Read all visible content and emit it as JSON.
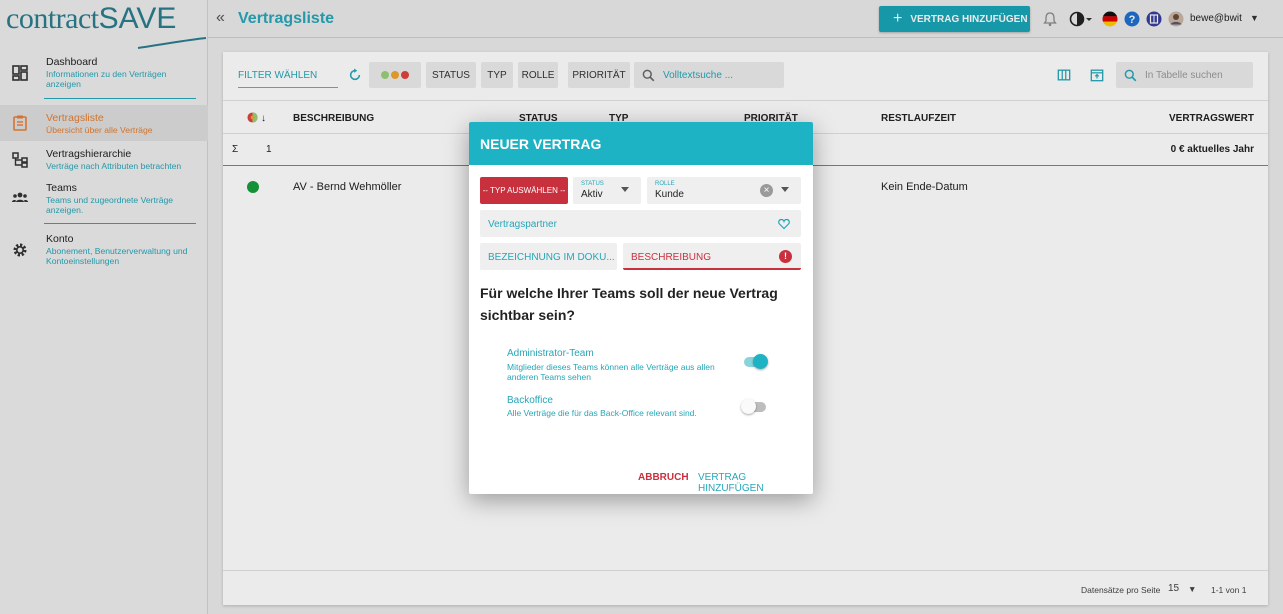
{
  "app": {
    "logo_text_a": "contract",
    "logo_text_b": "SAVE"
  },
  "sidebar": {
    "items": [
      {
        "title": "Dashboard",
        "subtitle": "Informationen zu den Verträgen anzeigen",
        "icon": "dashboard-icon"
      },
      {
        "title": "Vertragsliste",
        "subtitle": "Übersicht über alle Verträge",
        "icon": "clipboard-icon"
      },
      {
        "title": "Vertragshierarchie",
        "subtitle": "Verträge nach Attributen betrachten",
        "icon": "hierarchy-icon"
      },
      {
        "title": "Teams",
        "subtitle": "Teams und zugeordnete Verträge anzeigen.",
        "icon": "teams-icon"
      },
      {
        "title": "Konto",
        "subtitle": "Abonement, Benutzerverwaltung und Kontoeinstellungen",
        "icon": "gear-icon"
      }
    ]
  },
  "header": {
    "title": "Vertragsliste",
    "add_button": "VERTRAG HINZUFÜGEN",
    "user": "bewe@bwit"
  },
  "toolbar": {
    "filter_label": "FILTER WÄHLEN",
    "chips": [
      "STATUS",
      "TYP",
      "ROLLE",
      "PRIORITÄT"
    ],
    "fulltext_placeholder": "Volltextsuche ...",
    "table_search_placeholder": "In Tabelle suchen"
  },
  "table": {
    "headers": [
      "BESCHREIBUNG",
      "STATUS",
      "TYP",
      "PRIORITÄT",
      "RESTLAUFZEIT",
      "VERTRAGSWERT"
    ],
    "sum_symbol": "Σ",
    "sum_count": "1",
    "sum_value": "0 € aktuelles Jahr",
    "rows": [
      {
        "beschreibung": "AV - Bernd Wehmöller",
        "restlaufzeit": "Kein Ende-Datum"
      }
    ],
    "footer": {
      "per_page_label": "Datensätze pro Seite",
      "per_page": "15",
      "range": "1-1 von 1"
    }
  },
  "dialog": {
    "title": "NEUER VERTRAG",
    "typ_button": "-- TYP AUSWÄHLEN --",
    "status_label": "STATUS",
    "status_value": "Aktiv",
    "rolle_label": "ROLLE",
    "rolle_value": "Kunde",
    "partner_placeholder": "Vertragspartner",
    "bezeichnung_placeholder": "BEZEICHNUNG IM DOKU...",
    "beschreibung_placeholder": "BESCHREIBUNG",
    "question": "Für welche Ihrer Teams soll der neue Vertrag sichtbar sein?",
    "teams": [
      {
        "name": "Administrator-Team",
        "desc": "Mitglieder dieses Teams können alle Verträge aus allen anderen Teams sehen",
        "enabled": true
      },
      {
        "name": "Backoffice",
        "desc": "Alle Verträge die für das Back-Office relevant sind.",
        "enabled": false
      }
    ],
    "cancel": "ABBRUCH",
    "submit": "VERTRAG HINZUFÜGEN"
  },
  "colors": {
    "accent": "#1eb3c4",
    "error": "#c9303e",
    "active_nav": "#e37e33",
    "status_green": "#169d3b"
  }
}
